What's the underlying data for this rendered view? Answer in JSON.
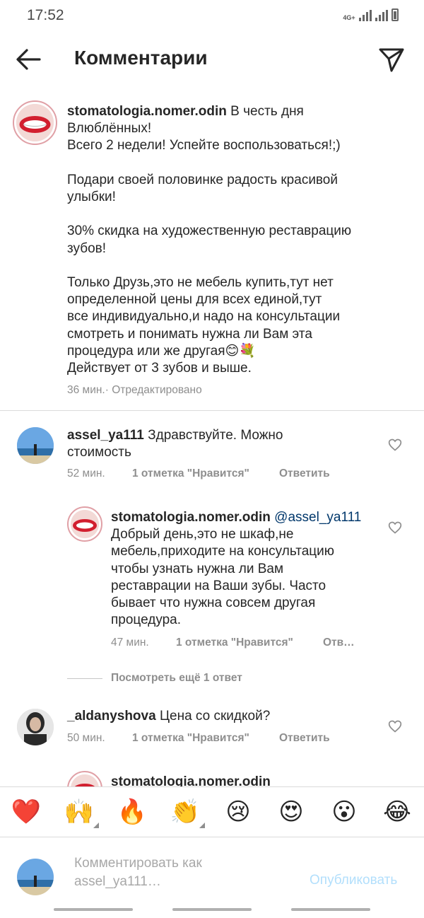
{
  "status_bar": {
    "time": "17:52",
    "network": "4G+"
  },
  "header": {
    "title": "Комментарии"
  },
  "caption": {
    "username": "stomatologia.nomer.odin",
    "text": " В честь дня\nВлюблённых!\nВсего 2 недели! Успейте воспользоваться!;)\n\nПодари своей половинке радость красивой\nулыбки!\n\n30% скидка на художественную реставрацию\nзубов!\n\nТолько Друзь,это не мебель купить,тут нет\nопределенной цены для всех единой,тут\nвсе индивидуально,и надо на консультации\nсмотреть и понимать нужна ли Вам эта\nпроцедура или же другая😊💐\nДействует от 3 зубов и выше.",
    "time": "36 мин.",
    "edited": " · Отредактировано"
  },
  "comments": [
    {
      "username": "assel_ya111",
      "text": " Здравствуйте. Можно\nстоимость",
      "time": "52 мин.",
      "likes": "1 отметка \"Нравится\"",
      "reply": "Ответить"
    },
    {
      "username": "stomatologia.nomer.odin",
      "mention": " @assel_ya111",
      "text": "\nДобрый день,это не шкаф,не\nмебель,приходите на консультацию\nчтобы узнать нужна ли Вам\nреставрации на Ваши зубы. Часто\nбывает что нужна совсем другая\nпроцедура.",
      "time": "47 мин.",
      "likes": "1 отметка \"Нравится\"",
      "reply": "Отв…"
    },
    {
      "username": "_aldanyshova",
      "text": " Цена со скидкой?",
      "time": "50 мин.",
      "likes": "1 отметка \"Нравится\"",
      "reply": "Ответить"
    },
    {
      "username": "stomatologia.nomer.odin"
    }
  ],
  "view_more": "Посмотреть ещё 1 ответ",
  "emoji_bar": [
    {
      "glyph": "❤️",
      "name": "heart-emoji"
    },
    {
      "glyph": "🙌",
      "name": "raised-hands-emoji"
    },
    {
      "glyph": "🔥",
      "name": "fire-emoji"
    },
    {
      "glyph": "👏",
      "name": "clapping-emoji"
    },
    {
      "glyph": "😢",
      "name": "crying-emoji"
    },
    {
      "glyph": "😍",
      "name": "heart-eyes-emoji"
    },
    {
      "glyph": "😮",
      "name": "surprised-emoji"
    },
    {
      "glyph": "😂",
      "name": "laughing-emoji"
    }
  ],
  "composer": {
    "placeholder": "Комментировать как\nassel_ya111…",
    "publish": "Опубликовать"
  },
  "colors": {
    "accent_disabled": "#b2dffc",
    "mention": "#00376b",
    "meta": "#8e8e8e"
  }
}
